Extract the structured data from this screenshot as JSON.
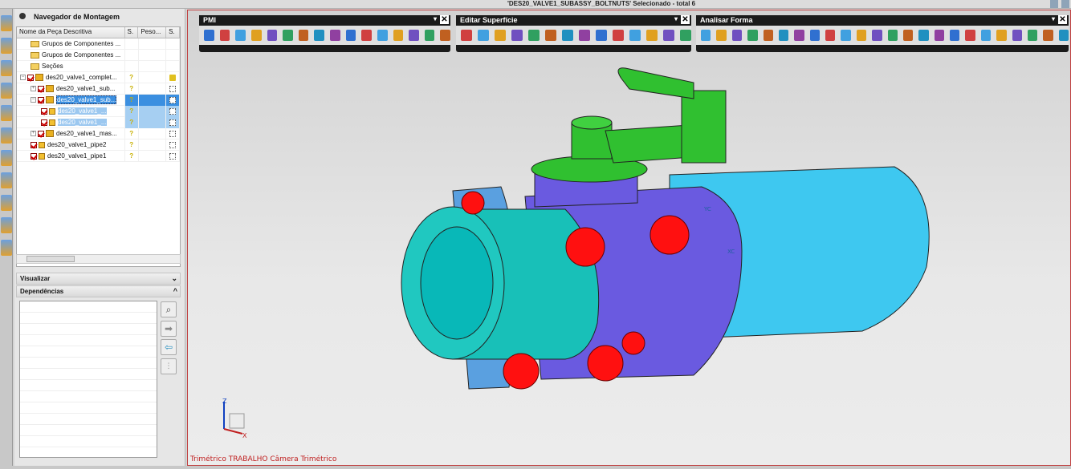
{
  "status_bar": {
    "selection_text": "'DES20_VALVE1_SUBASSY_BOLTNUTS' Selecionado - total 6"
  },
  "navigator": {
    "title": "Navegador de Montagem",
    "columns": [
      "Nome da Peça Descritiva",
      "S.",
      "Peso...",
      "S."
    ],
    "rows": [
      {
        "label": "Grupos de Componentes ...",
        "icon": "folder-icon",
        "indent": 1
      },
      {
        "label": "Grupos de Componentes ...",
        "icon": "folder-icon",
        "indent": 1
      },
      {
        "label": "Seções",
        "icon": "folder-icon",
        "indent": 1
      },
      {
        "label": "des20_valve1_complet...",
        "icon": "assembly-icon",
        "indent": 0,
        "expander": "−",
        "checked": true,
        "status": "?",
        "last": "lock"
      },
      {
        "label": "des20_valve1_sub...",
        "icon": "assembly-icon",
        "indent": 1,
        "expander": "+",
        "checked": true,
        "status": "?",
        "last": "box"
      },
      {
        "label": "des20_valve1_sub...",
        "icon": "assembly-icon",
        "indent": 1,
        "expander": "−",
        "checked": true,
        "status": "?",
        "last": "box",
        "selected": "primary"
      },
      {
        "label": "des20_valve1_...",
        "icon": "part-icon",
        "indent": 2,
        "checked": true,
        "status": "?",
        "last": "box",
        "selected": "secondary"
      },
      {
        "label": "des20_valve1_...",
        "icon": "part-icon",
        "indent": 2,
        "checked": true,
        "status": "?",
        "last": "box",
        "selected": "secondary"
      },
      {
        "label": "des20_valve1_mas...",
        "icon": "assembly-icon",
        "indent": 1,
        "expander": "+",
        "checked": true,
        "status": "?",
        "last": "box"
      },
      {
        "label": "des20_valve1_pipe2",
        "icon": "part-icon",
        "indent": 1,
        "checked": true,
        "status": "?",
        "last": "box"
      },
      {
        "label": "des20_valve1_pipe1",
        "icon": "part-icon",
        "indent": 1,
        "checked": true,
        "status": "?",
        "last": "box"
      }
    ],
    "visualizar": "Visualizar",
    "dependencias": "Dependências"
  },
  "toolbars": [
    {
      "title": "PMI"
    },
    {
      "title": "Editar Superfície"
    },
    {
      "title": "Analisar Forma"
    }
  ],
  "viewport": {
    "caption": "Trimétrico TRABALHO Câmera Trimétrico",
    "axis_labels": {
      "z": "Z",
      "x": "X",
      "yc": "YC",
      "xc": "XC"
    },
    "colors": {
      "pipe": "#2ad0d0",
      "body": "#6a5ae0",
      "cap": "#40e8f0",
      "bolts": "#ff1010",
      "handle": "#30c030",
      "border": "#c04040"
    }
  }
}
